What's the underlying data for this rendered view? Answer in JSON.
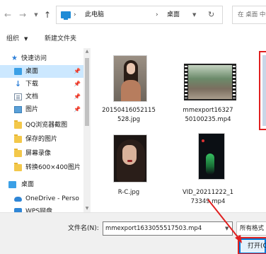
{
  "address_bar": {
    "back_icon": "back-arrow-icon",
    "forward_icon": "forward-arrow-icon",
    "recent_icon": "chevron-down-icon",
    "up_icon": "up-arrow-icon",
    "crumbs": [
      "此电脑",
      "桌面"
    ],
    "search_placeholder": "在 桌面 中"
  },
  "toolbar": {
    "organize_label": "组织",
    "new_folder_label": "新建文件夹"
  },
  "sidebar": {
    "items": [
      {
        "label": "快速访问",
        "icon": "star-icon",
        "pinned": false,
        "selected": false
      },
      {
        "label": "桌面",
        "icon": "desktop-icon",
        "pinned": true,
        "selected": true
      },
      {
        "label": "下载",
        "icon": "download-icon",
        "pinned": true,
        "selected": false
      },
      {
        "label": "文档",
        "icon": "document-icon",
        "pinned": true,
        "selected": false
      },
      {
        "label": "图片",
        "icon": "picture-icon",
        "pinned": true,
        "selected": false
      },
      {
        "label": "QQ浏览器截图",
        "icon": "folder-icon",
        "pinned": false,
        "selected": false
      },
      {
        "label": "保存的图片",
        "icon": "folder-icon",
        "pinned": false,
        "selected": false
      },
      {
        "label": "屏幕录像",
        "icon": "folder-icon",
        "pinned": false,
        "selected": false
      },
      {
        "label": "转换600×400图片",
        "icon": "folder-icon",
        "pinned": false,
        "selected": false
      },
      {
        "label": "桌面",
        "icon": "desktop-icon",
        "pinned": false,
        "selected": false
      },
      {
        "label": "OneDrive - Perso",
        "icon": "onedrive-icon",
        "pinned": false,
        "selected": false
      },
      {
        "label": "WPS网盘",
        "icon": "wps-cloud-icon",
        "pinned": false,
        "selected": false
      }
    ]
  },
  "files": [
    {
      "name_line1": "20150416052115",
      "name_line2": "528.jpg"
    },
    {
      "name_line1": "mmexport16327",
      "name_line2": "50100235.mp4"
    },
    {
      "name_line1": "R-C.jpg",
      "name_line2": ""
    },
    {
      "name_line1": "VID_20211222_1",
      "name_line2": "73349.mp4"
    }
  ],
  "bottom": {
    "filename_label": "文件名(N):",
    "filename_value": "mmexport1633055517503.mp4",
    "filetype_value": "所有格式",
    "open_label": "打开(O)"
  },
  "colors": {
    "selection": "#cce8ff",
    "accent": "#0078d7",
    "annotation": "#e02020"
  }
}
